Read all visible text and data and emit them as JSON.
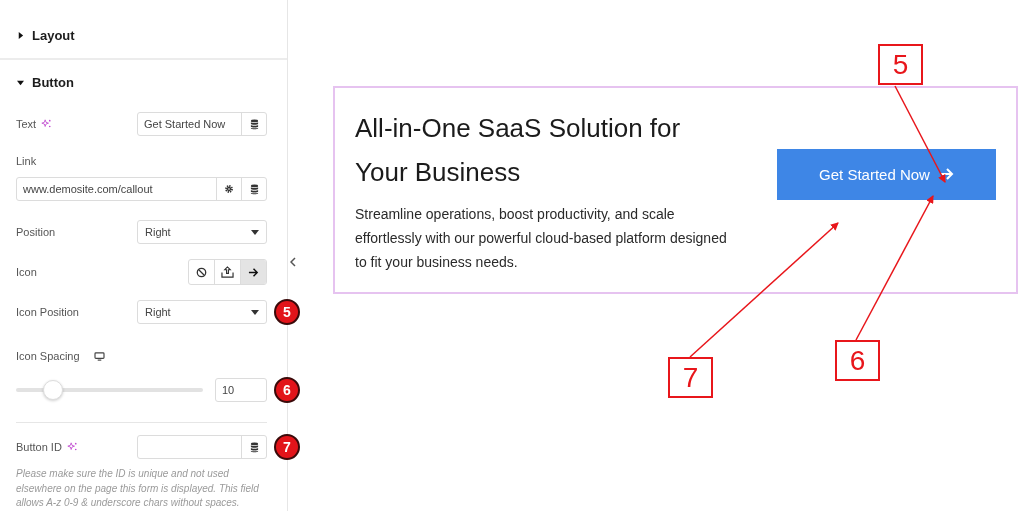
{
  "sections": [
    {
      "title": "Layout",
      "expanded": false
    },
    {
      "title": "Button",
      "expanded": true
    }
  ],
  "controls": [
    {
      "kind": "text",
      "label": "Text",
      "ai": true,
      "value": "Get Started Now"
    },
    {
      "kind": "link",
      "label": "Link",
      "value": "www.demosite.com/callout"
    },
    {
      "kind": "select",
      "label": "Position",
      "value": "Right"
    },
    {
      "kind": "choices",
      "label": "Icon",
      "options": [
        {
          "kind": "none",
          "selected": false
        },
        {
          "kind": "upload",
          "selected": false
        },
        {
          "kind": "arrow",
          "selected": true
        }
      ]
    },
    {
      "kind": "select",
      "label": "Icon Position",
      "value": "Right",
      "badge": "5"
    },
    {
      "kind": "slider",
      "label": "Icon Spacing",
      "responsive": true,
      "level": 0.2,
      "value": "10",
      "badge": "6"
    },
    {
      "kind": "text",
      "label": "Button ID",
      "ai": true,
      "badge": "7",
      "help": "Please make sure the ID is unique and not used elsewhere on the page this form is displayed. This field allows A-z  0-9 & underscore chars without spaces."
    }
  ],
  "preview": {
    "title": "All-in-One SaaS Solution for Your Business",
    "description": "Streamline operations, boost productivity, and scale effortlessly with our powerful cloud-based platform designed to fit your business needs.",
    "button": {
      "label": "Get Started Now"
    }
  },
  "annotations": [
    {
      "label": "5"
    },
    {
      "label": "7"
    },
    {
      "label": "6"
    }
  ]
}
